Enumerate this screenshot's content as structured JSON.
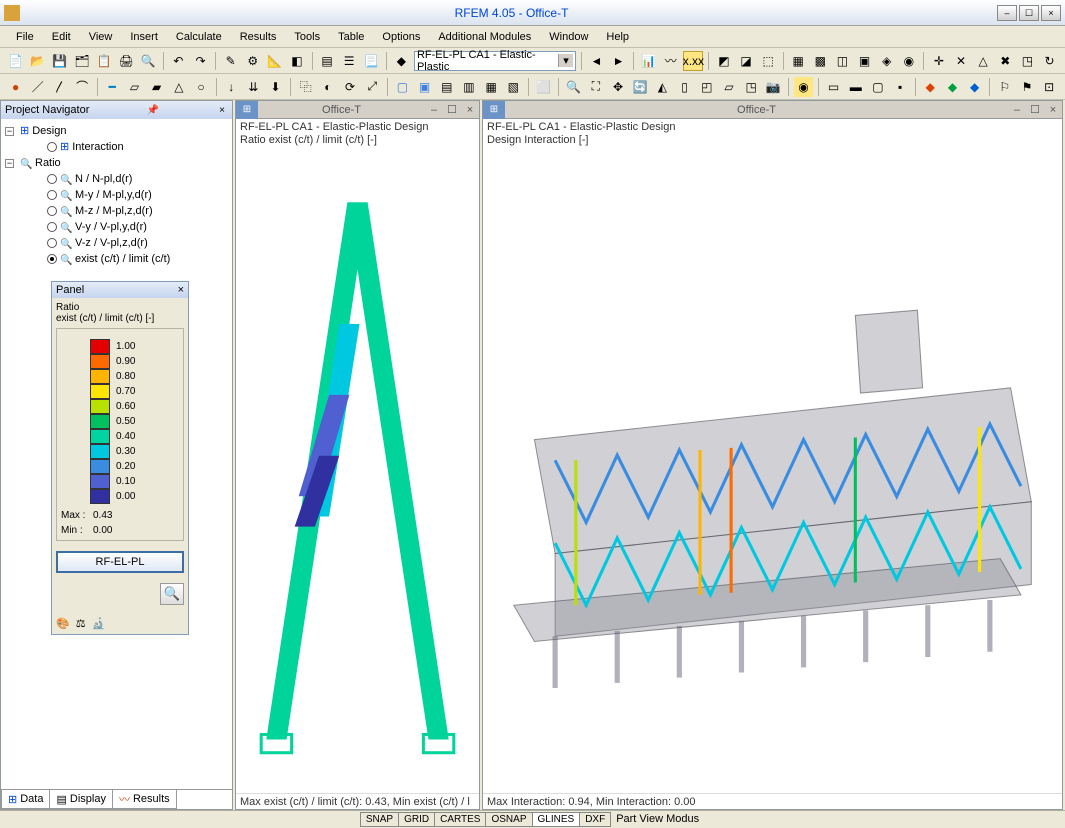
{
  "app": {
    "title": "RFEM 4.05 - Office-T"
  },
  "menu": [
    "File",
    "Edit",
    "View",
    "Insert",
    "Calculate",
    "Results",
    "Tools",
    "Table",
    "Options",
    "Additional Modules",
    "Window",
    "Help"
  ],
  "combo": "RF-EL-PL CA1 - Elastic-Plastic",
  "navigator": {
    "title": "Project Navigator",
    "tree": {
      "design": "Design",
      "interaction": "Interaction",
      "ratio": "Ratio",
      "items": [
        "N / N-pl,d(r)",
        "M-y / M-pl,y,d(r)",
        "M-z / M-pl,z,d(r)",
        "V-y / V-pl,y,d(r)",
        "V-z / V-pl,z,d(r)",
        "exist (c/t) / limit (c/t)"
      ]
    },
    "tabs": [
      "Data",
      "Display",
      "Results"
    ]
  },
  "panel": {
    "title": "Panel",
    "ratio_label": "Ratio",
    "ratio_sub": "exist (c/t) / limit (c/t) [-]",
    "scale": [
      {
        "c": "#e40000",
        "v": "1.00"
      },
      {
        "c": "#ff6a00",
        "v": "0.90"
      },
      {
        "c": "#ffb400",
        "v": "0.80"
      },
      {
        "c": "#ffe600",
        "v": "0.70"
      },
      {
        "c": "#b8e000",
        "v": "0.60"
      },
      {
        "c": "#00c060",
        "v": "0.50"
      },
      {
        "c": "#00d4a0",
        "v": "0.40"
      },
      {
        "c": "#00c8e0",
        "v": "0.30"
      },
      {
        "c": "#3a8ce0",
        "v": "0.20"
      },
      {
        "c": "#5060d0",
        "v": "0.10"
      },
      {
        "c": "#3030a0",
        "v": "0.00"
      }
    ],
    "max_label": "Max :",
    "max": "0.43",
    "min_label": "Min :",
    "min": "0.00",
    "button": "RF-EL-PL"
  },
  "view1": {
    "title": "Office-T",
    "line1": "RF-EL-PL CA1 - Elastic-Plastic Design",
    "line2": "Ratio exist (c/t) / limit (c/t) [-]",
    "status": "Max exist (c/t) / limit (c/t): 0.43, Min exist (c/t) / l"
  },
  "view2": {
    "title": "Office-T",
    "line1": "RF-EL-PL CA1 - Elastic-Plastic Design",
    "line2": "Design Interaction [-]",
    "status": "Max Interaction: 0.94, Min Interaction: 0.00"
  },
  "statusbar": {
    "tabs": [
      "SNAP",
      "GRID",
      "CARTES",
      "OSNAP",
      "GLINES",
      "DXF"
    ],
    "mode": "Part View Modus"
  },
  "colors": {
    "accent": "#3a6ea5",
    "frame": "#00d49a"
  }
}
